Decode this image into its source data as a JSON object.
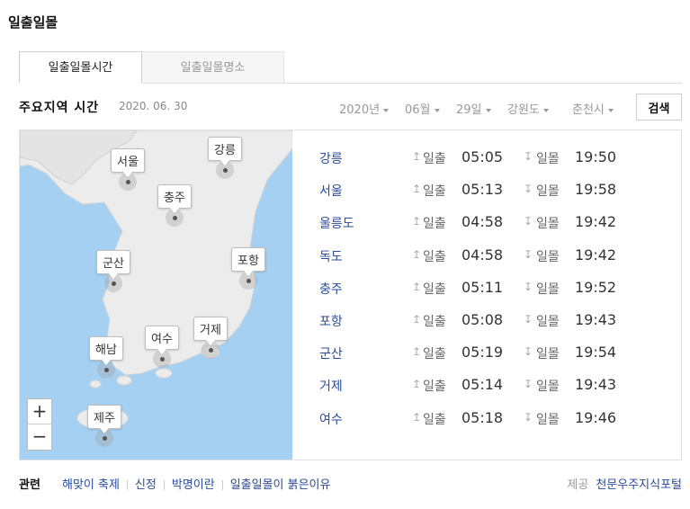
{
  "page_title": "일출일몰",
  "tabs": [
    {
      "label": "일출일몰시간",
      "active": true
    },
    {
      "label": "일출일몰명소",
      "active": false
    }
  ],
  "toolbar": {
    "section_title": "주요지역 시간",
    "date": "2020. 06. 30",
    "year": "2020년",
    "month": "06월",
    "day": "29일",
    "province": "강원도",
    "city": "춘천시",
    "search_label": "검색"
  },
  "map": {
    "zoom_in": "+",
    "zoom_out": "−",
    "pins": [
      "강릉",
      "서울",
      "충주",
      "군산",
      "포항",
      "여수",
      "거제",
      "해남",
      "제주"
    ]
  },
  "rise_label": "일출",
  "set_label": "일몰",
  "rise_icon": "↥",
  "set_icon": "↧",
  "rows": [
    {
      "city": "강릉",
      "rise": "05:05",
      "set": "19:50"
    },
    {
      "city": "서울",
      "rise": "05:13",
      "set": "19:58"
    },
    {
      "city": "울릉도",
      "rise": "04:58",
      "set": "19:42"
    },
    {
      "city": "독도",
      "rise": "04:58",
      "set": "19:42"
    },
    {
      "city": "충주",
      "rise": "05:11",
      "set": "19:52"
    },
    {
      "city": "포항",
      "rise": "05:08",
      "set": "19:43"
    },
    {
      "city": "군산",
      "rise": "05:19",
      "set": "19:54"
    },
    {
      "city": "거제",
      "rise": "05:14",
      "set": "19:43"
    },
    {
      "city": "여수",
      "rise": "05:18",
      "set": "19:46"
    }
  ],
  "footer": {
    "related_title": "관련",
    "links": [
      "해맞이 축제",
      "신정",
      "박명이란",
      "일출일몰이 붉은이유"
    ],
    "provider_label": "제공",
    "provider": "천문우주지식포털"
  },
  "colors": {
    "sea": "#a6d0f2",
    "land": "#ececec",
    "city_text": "#2a4b9a"
  }
}
